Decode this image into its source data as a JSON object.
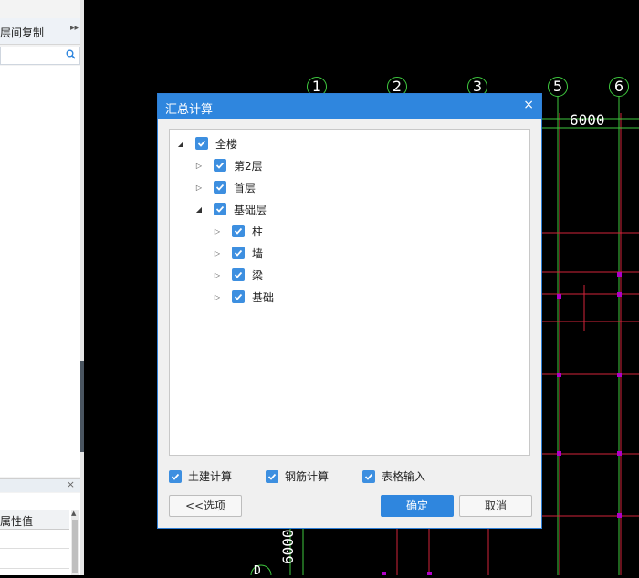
{
  "left_panel": {
    "toolbar_label": "层间复制",
    "toolbar_arrow": "▸▸",
    "search_placeholder": "",
    "close_glyph": "×",
    "prop_header": "属性值"
  },
  "cad": {
    "axis_labels": [
      "1",
      "2",
      "3",
      "5",
      "6"
    ],
    "dim_top": "6000",
    "dim_left": "6000",
    "bottom_label": "D"
  },
  "dialog": {
    "title": "汇总计算",
    "close_glyph": "×",
    "tree": [
      {
        "label": "全楼",
        "level": 0,
        "expanded": true,
        "checked": true
      },
      {
        "label": "第2层",
        "level": 1,
        "expanded": false,
        "checked": true
      },
      {
        "label": "首层",
        "level": 1,
        "expanded": false,
        "checked": true
      },
      {
        "label": "基础层",
        "level": 1,
        "expanded": true,
        "checked": true
      },
      {
        "label": "柱",
        "level": 2,
        "expanded": false,
        "checked": true
      },
      {
        "label": "墙",
        "level": 2,
        "expanded": false,
        "checked": true
      },
      {
        "label": "梁",
        "level": 2,
        "expanded": false,
        "checked": true
      },
      {
        "label": "基础",
        "level": 2,
        "expanded": false,
        "checked": true
      }
    ],
    "options": [
      {
        "label": "土建计算",
        "checked": true
      },
      {
        "label": "钢筋计算",
        "checked": true
      },
      {
        "label": "表格输入",
        "checked": true
      }
    ],
    "buttons": {
      "options": "<<选项",
      "ok": "确定",
      "cancel": "取消"
    }
  },
  "colors": {
    "accent": "#2f86de",
    "checkbox": "#3d8fe0",
    "grid_red": "#d2233a",
    "axis_green": "#3ec93e",
    "marker": "#b000c8"
  }
}
